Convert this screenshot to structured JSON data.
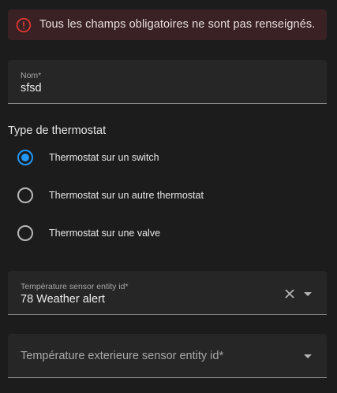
{
  "alert": {
    "message": "Tous les champs obligatoires ne sont pas renseignés.",
    "icon": "alert-circle-icon",
    "color": "#e53935"
  },
  "name_field": {
    "label": "Nom*",
    "value": "sfsd"
  },
  "thermostat_type": {
    "title": "Type de thermostat",
    "options": [
      {
        "label": "Thermostat sur un switch",
        "selected": true
      },
      {
        "label": "Thermostat sur un autre thermostat",
        "selected": false
      },
      {
        "label": "Thermostat sur une valve",
        "selected": false
      }
    ],
    "accent_color": "#2196f3"
  },
  "temp_sensor": {
    "label": "Température sensor entity id*",
    "value": "78 Weather alert",
    "clear_icon": "close-icon",
    "dropdown_icon": "caret-down-icon"
  },
  "ext_temp_sensor": {
    "placeholder": "Température exterieure sensor entity id*",
    "dropdown_icon": "caret-down-icon"
  }
}
